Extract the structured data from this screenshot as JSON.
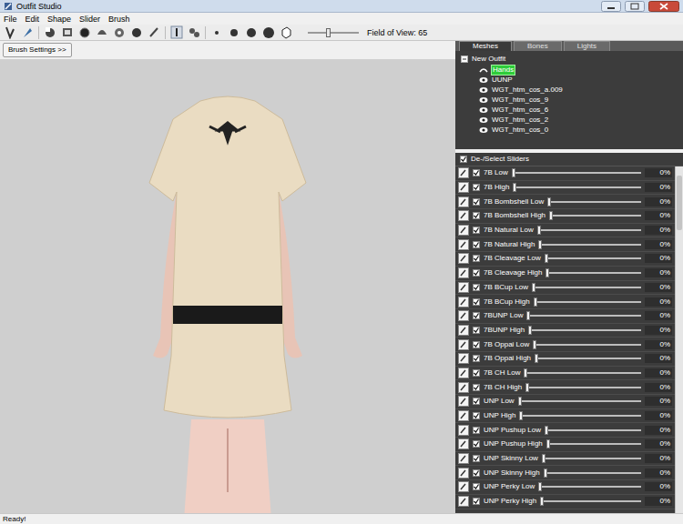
{
  "window": {
    "title": "Outfit Studio"
  },
  "menu": [
    "File",
    "Edit",
    "Shape",
    "Slider",
    "Brush"
  ],
  "toolbar": {
    "field_of_view": {
      "label": "Field of View: 65",
      "level": 0.4
    }
  },
  "brush_settings_button": "Brush Settings >>",
  "tabs": [
    {
      "label": "Meshes",
      "selected": true
    },
    {
      "label": "Bones",
      "selected": false
    },
    {
      "label": "Lights",
      "selected": false
    }
  ],
  "tree": {
    "root": "New Outfit",
    "expanded": true,
    "items": [
      {
        "label": "Hands",
        "selected": true,
        "kind": "curve"
      },
      {
        "label": "UUNP",
        "selected": false,
        "kind": "eye"
      },
      {
        "label": "WGT_htm_cos_a.009",
        "selected": false,
        "kind": "eye"
      },
      {
        "label": "WGT_htm_cos_9",
        "selected": false,
        "kind": "eye"
      },
      {
        "label": "WGT_htm_cos_6",
        "selected": false,
        "kind": "eye"
      },
      {
        "label": "WGT_htm_cos_2",
        "selected": false,
        "kind": "eye"
      },
      {
        "label": "WGT_htm_cos_0",
        "selected": false,
        "kind": "eye"
      }
    ]
  },
  "sliders": {
    "header": {
      "label": "De-/Select Sliders",
      "checked": true
    },
    "items": [
      {
        "name": "7B Low",
        "checked": true,
        "level": 0,
        "reading": "0%"
      },
      {
        "name": "7B High",
        "checked": true,
        "level": 0,
        "reading": "0%"
      },
      {
        "name": "7B Bombshell Low",
        "checked": true,
        "level": 0,
        "reading": "0%"
      },
      {
        "name": "7B Bombshell High",
        "checked": true,
        "level": 0,
        "reading": "0%"
      },
      {
        "name": "7B Natural Low",
        "checked": true,
        "level": 0,
        "reading": "0%"
      },
      {
        "name": "7B Natural High",
        "checked": true,
        "level": 0,
        "reading": "0%"
      },
      {
        "name": "7B Cleavage Low",
        "checked": true,
        "level": 0,
        "reading": "0%"
      },
      {
        "name": "7B Cleavage High",
        "checked": true,
        "level": 0,
        "reading": "0%"
      },
      {
        "name": "7B BCup Low",
        "checked": true,
        "level": 0,
        "reading": "0%"
      },
      {
        "name": "7B BCup High",
        "checked": true,
        "level": 0,
        "reading": "0%"
      },
      {
        "name": "7BUNP Low",
        "checked": true,
        "level": 0,
        "reading": "0%"
      },
      {
        "name": "7BUNP High",
        "checked": true,
        "level": 0,
        "reading": "0%"
      },
      {
        "name": "7B Oppai Low",
        "checked": true,
        "level": 0,
        "reading": "0%"
      },
      {
        "name": "7B Oppai High",
        "checked": true,
        "level": 0,
        "reading": "0%"
      },
      {
        "name": "7B CH Low",
        "checked": true,
        "level": 0,
        "reading": "0%"
      },
      {
        "name": "7B CH High",
        "checked": true,
        "level": 0,
        "reading": "0%"
      },
      {
        "name": "UNP Low",
        "checked": true,
        "level": 0,
        "reading": "0%"
      },
      {
        "name": "UNP High",
        "checked": true,
        "level": 0,
        "reading": "0%"
      },
      {
        "name": "UNP Pushup Low",
        "checked": true,
        "level": 0,
        "reading": "0%"
      },
      {
        "name": "UNP Pushup High",
        "checked": true,
        "level": 0,
        "reading": "0%"
      },
      {
        "name": "UNP Skinny Low",
        "checked": true,
        "level": 0,
        "reading": "0%"
      },
      {
        "name": "UNP Skinny High",
        "checked": true,
        "level": 0,
        "reading": "0%"
      },
      {
        "name": "UNP Perky Low",
        "checked": true,
        "level": 0,
        "reading": "0%"
      },
      {
        "name": "UNP Perky High",
        "checked": true,
        "level": 0,
        "reading": "0%"
      }
    ]
  },
  "status_bar": "Ready!"
}
